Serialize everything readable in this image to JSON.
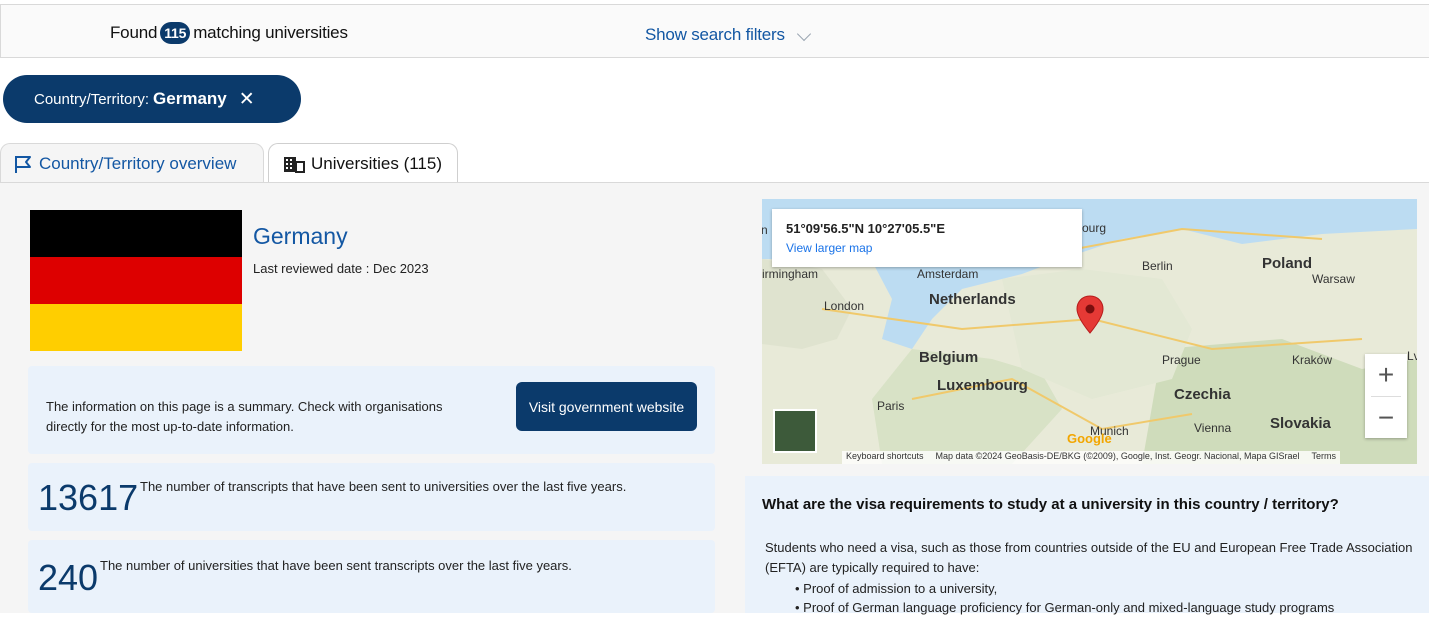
{
  "search": {
    "found_prefix": "Found",
    "found_count": "115",
    "found_suffix": "matching universities",
    "show_filters_label": "Show search filters"
  },
  "filter_chip": {
    "label": "Country/Territory:",
    "value": "Germany",
    "close_glyph": "✕"
  },
  "tabs": [
    {
      "label": "Country/Territory overview",
      "icon": "flag-icon",
      "active": true
    },
    {
      "label": "Universities (115)",
      "icon": "building-icon",
      "active": false
    }
  ],
  "country": {
    "name": "Germany",
    "reviewed": "Last reviewed date : Dec 2023",
    "flag_colors": [
      "#000000",
      "#dd0000",
      "#ffce00"
    ]
  },
  "info": {
    "text": "The information on this page is a summary. Check with organisations directly for the most up-to-date information.",
    "button_label": "Visit government website"
  },
  "stats": [
    {
      "value": "13617",
      "description": "The number of transcripts that have been sent to universities over the last five years."
    },
    {
      "value": "240",
      "description": "The number of universities that have been sent transcripts over the last five years."
    }
  ],
  "map": {
    "coords": "51°09'56.5\"N 10°27'05.5\"E",
    "larger_map_link": "View larger map",
    "labels": {
      "netherlands": "Netherlands",
      "amsterdam": "Amsterdam",
      "london": "London",
      "belgium": "Belgium",
      "luxembourg": "Luxembourg",
      "paris": "Paris",
      "berlin": "Berlin",
      "poland": "Poland",
      "warsaw": "Warsaw",
      "prague": "Prague",
      "czechia": "Czechia",
      "krakow": "Kraków",
      "vienna": "Vienna",
      "slovakia": "Slovakia",
      "munich": "Munich",
      "birmingham": "irmingham",
      "hamburg": "ourg",
      "edge_left": "n",
      "edge_right": "Lv"
    },
    "zoom_in": "+",
    "zoom_out": "−",
    "attribution": {
      "shortcuts": "Keyboard shortcuts",
      "data": "Map data ©2024 GeoBasis-DE/BKG (©2009), Google, Inst. Geogr. Nacional, Mapa GISrael",
      "terms": "Terms"
    },
    "logo": "Google",
    "marker_color": "#e53935"
  },
  "visa": {
    "heading": "What are the visa requirements to study at a university in this country / territory?",
    "intro": "Students who need a visa, such as those from countries outside of the EU and European Free Trade Association (EFTA) are typically required to have:",
    "items": [
      "Proof of admission to a university,",
      "Proof of German language proficiency for German-only and mixed-language study programs"
    ]
  }
}
